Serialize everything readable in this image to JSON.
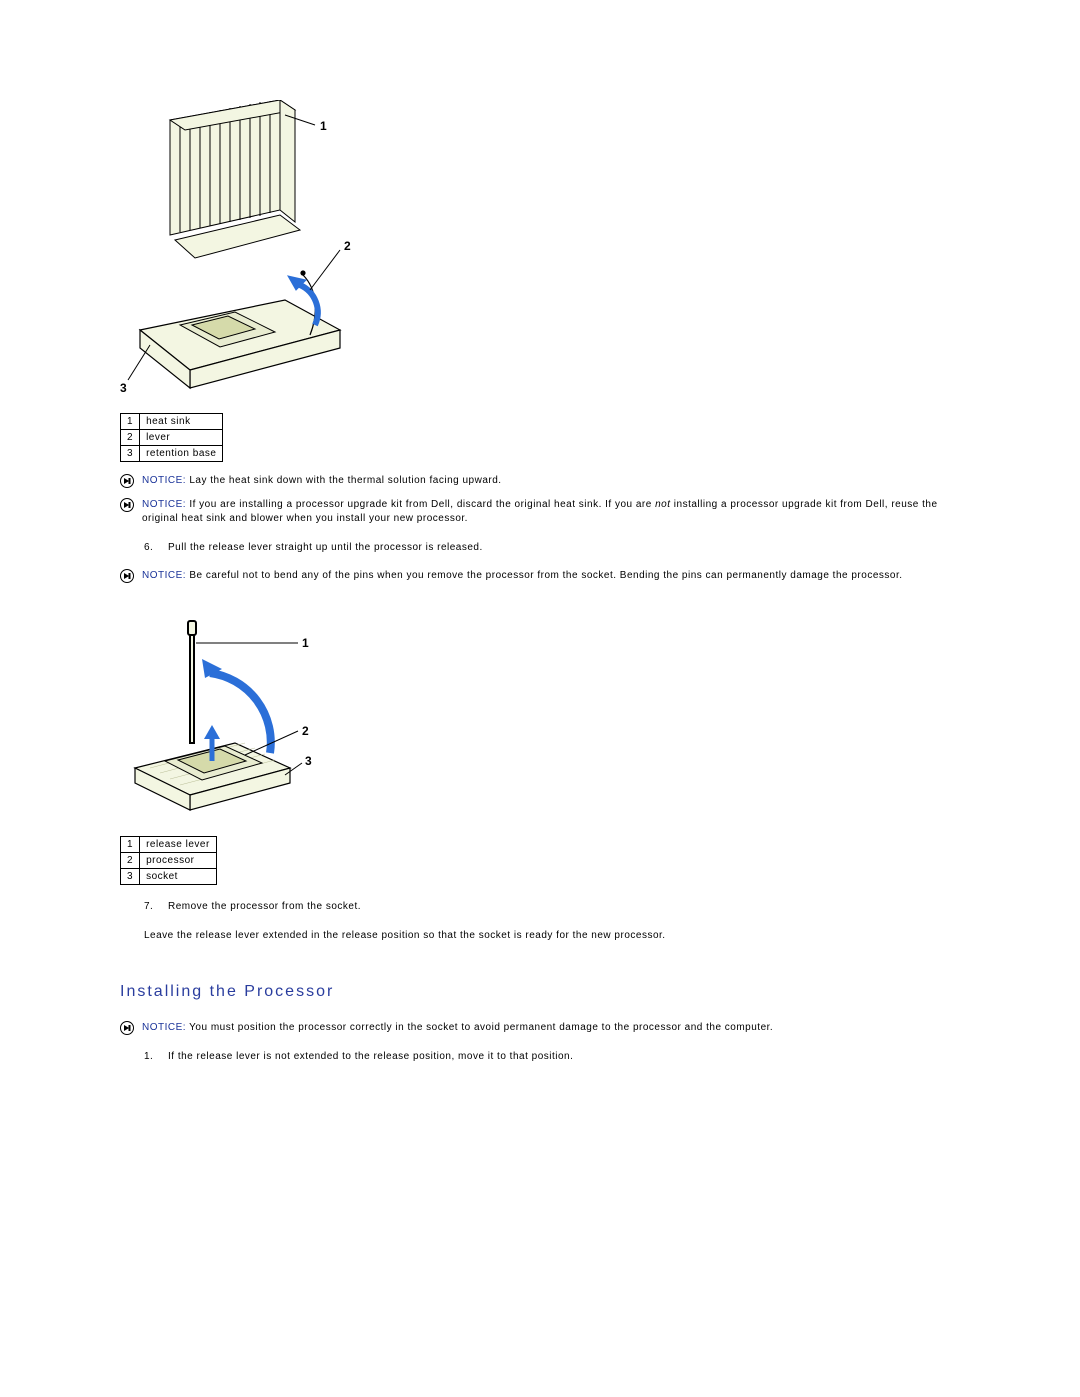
{
  "figure1": {
    "callouts": {
      "c1": "1",
      "c2": "2",
      "c3": "3"
    },
    "legend": [
      {
        "n": "1",
        "label": "heat sink"
      },
      {
        "n": "2",
        "label": "lever"
      },
      {
        "n": "3",
        "label": "retention base"
      }
    ]
  },
  "notice1": {
    "label": "NOTICE:",
    "text": " Lay the heat sink down with the thermal solution facing upward."
  },
  "notice2": {
    "label": "NOTICE:",
    "text_before": " If you are installing a processor upgrade kit from Dell, discard the original heat sink. If you are ",
    "text_italic": "not",
    "text_after": " installing a processor upgrade kit from Dell, reuse the original heat sink and blower when you install your new processor."
  },
  "step6": {
    "num": "6.",
    "text": "Pull the release lever straight up until the processor is released."
  },
  "notice3": {
    "label": "NOTICE:",
    "text": " Be careful not to bend any of the pins when you remove the processor from the socket. Bending the pins can permanently damage the processor."
  },
  "figure2": {
    "callouts": {
      "c1": "1",
      "c2": "2",
      "c3": "3"
    },
    "legend": [
      {
        "n": "1",
        "label": "release lever"
      },
      {
        "n": "2",
        "label": "processor"
      },
      {
        "n": "3",
        "label": "socket"
      }
    ]
  },
  "step7": {
    "num": "7.",
    "text": "Remove the processor from the socket."
  },
  "para1": "Leave the release lever extended in the release position so that the socket is ready for the new processor.",
  "section_heading": "Installing the Processor",
  "notice4": {
    "label": "NOTICE:",
    "text": " You must position the processor correctly in the socket to avoid permanent damage to the processor and the computer."
  },
  "step_install1": {
    "num": "1.",
    "text": "If the release lever is not extended to the release position, move it to that position."
  }
}
